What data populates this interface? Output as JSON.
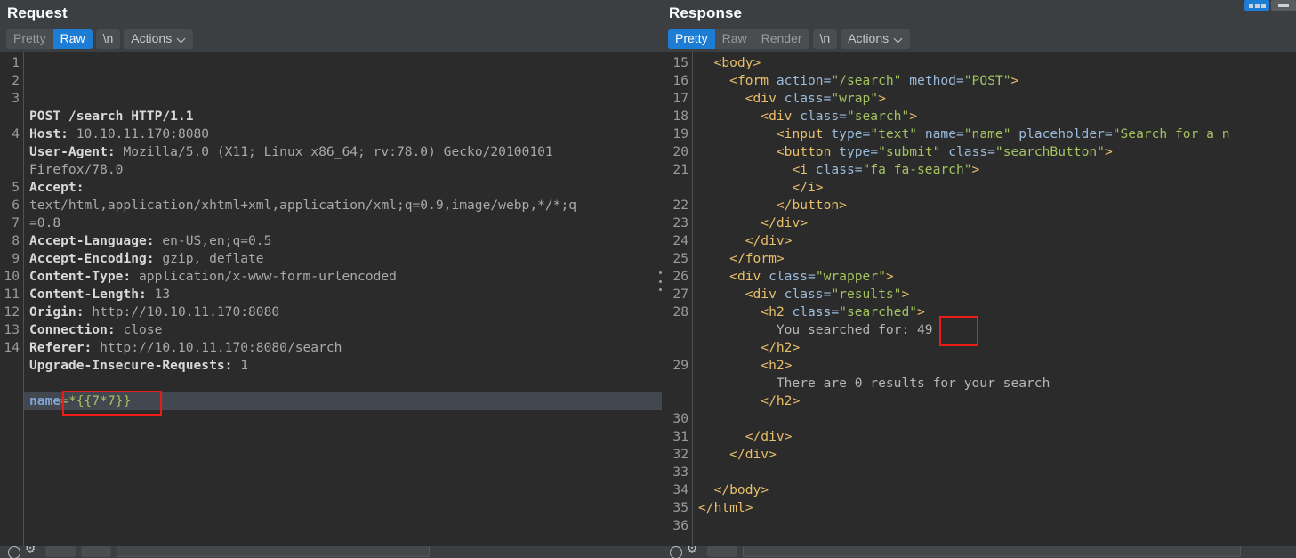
{
  "request": {
    "title": "Request",
    "tabs": [
      {
        "label": "Pretty",
        "state": "inactive"
      },
      {
        "label": "Raw",
        "state": "active"
      },
      {
        "label": "\\n",
        "state": "plain"
      }
    ],
    "actions_label": "Actions",
    "line_numbers": [
      "1",
      "2",
      "3",
      "",
      "4",
      "",
      "",
      "5",
      "6",
      "7",
      "8",
      "9",
      "10",
      "11",
      "12",
      "13",
      "14"
    ],
    "lines": [
      {
        "n": "1",
        "segments": [
          {
            "t": "POST /search HTTP/1.1",
            "c": "r-key"
          }
        ]
      },
      {
        "n": "2",
        "segments": [
          {
            "t": "Host: ",
            "c": "r-key"
          },
          {
            "t": "10.10.11.170:8080",
            "c": "r-val"
          }
        ]
      },
      {
        "n": "3",
        "segments": [
          {
            "t": "User-Agent: ",
            "c": "r-key"
          },
          {
            "t": "Mozilla/5.0 (X11; Linux x86_64; rv:78.0) Gecko/20100101",
            "c": "r-val"
          }
        ]
      },
      {
        "n": "",
        "segments": [
          {
            "t": "Firefox/78.0",
            "c": "r-val"
          }
        ]
      },
      {
        "n": "4",
        "segments": [
          {
            "t": "Accept:",
            "c": "r-key"
          }
        ]
      },
      {
        "n": "",
        "segments": [
          {
            "t": "text/html,application/xhtml+xml,application/xml;q=0.9,image/webp,*/*;q",
            "c": "r-val"
          }
        ]
      },
      {
        "n": "",
        "segments": [
          {
            "t": "=0.8",
            "c": "r-val"
          }
        ]
      },
      {
        "n": "5",
        "segments": [
          {
            "t": "Accept-Language: ",
            "c": "r-key"
          },
          {
            "t": "en-US,en;q=0.5",
            "c": "r-val"
          }
        ]
      },
      {
        "n": "6",
        "segments": [
          {
            "t": "Accept-Encoding: ",
            "c": "r-key"
          },
          {
            "t": "gzip, deflate",
            "c": "r-val"
          }
        ]
      },
      {
        "n": "7",
        "segments": [
          {
            "t": "Content-Type: ",
            "c": "r-key"
          },
          {
            "t": "application/x-www-form-urlencoded",
            "c": "r-val"
          }
        ]
      },
      {
        "n": "8",
        "segments": [
          {
            "t": "Content-Length: ",
            "c": "r-key"
          },
          {
            "t": "13",
            "c": "r-val"
          }
        ]
      },
      {
        "n": "9",
        "segments": [
          {
            "t": "Origin: ",
            "c": "r-key"
          },
          {
            "t": "http://10.10.11.170:8080",
            "c": "r-val"
          }
        ]
      },
      {
        "n": "10",
        "segments": [
          {
            "t": "Connection: ",
            "c": "r-key"
          },
          {
            "t": "close",
            "c": "r-val"
          }
        ]
      },
      {
        "n": "11",
        "segments": [
          {
            "t": "Referer: ",
            "c": "r-key"
          },
          {
            "t": "http://10.10.11.170:8080/search",
            "c": "r-val"
          }
        ]
      },
      {
        "n": "12",
        "segments": [
          {
            "t": "Upgrade-Insecure-Requests: ",
            "c": "r-key"
          },
          {
            "t": "1",
            "c": "r-val"
          }
        ]
      },
      {
        "n": "13",
        "segments": [
          {
            "t": "",
            "c": "r-val"
          }
        ]
      },
      {
        "n": "14",
        "segments": [
          {
            "t": "name",
            "c": "r-name"
          },
          {
            "t": "=*{{7*7}}",
            "c": "r-green"
          }
        ]
      }
    ],
    "payload_value": "name=*{{7*7}}"
  },
  "response": {
    "title": "Response",
    "tabs": [
      {
        "label": "Pretty",
        "state": "active"
      },
      {
        "label": "Raw",
        "state": "plain"
      },
      {
        "label": "Render",
        "state": "plain"
      },
      {
        "label": "\\n",
        "state": "plain"
      }
    ],
    "actions_label": "Actions",
    "lines": [
      {
        "n": "15",
        "segments": [
          {
            "t": "  ",
            "c": "h-text"
          },
          {
            "t": "<body>",
            "c": "h-tag"
          }
        ]
      },
      {
        "n": "16",
        "segments": [
          {
            "t": "    ",
            "c": "h-text"
          },
          {
            "t": "<form ",
            "c": "h-tag"
          },
          {
            "t": "action=",
            "c": "h-attr"
          },
          {
            "t": "\"/search\"",
            "c": "h-str"
          },
          {
            "t": " method=",
            "c": "h-attr"
          },
          {
            "t": "\"POST\"",
            "c": "h-str"
          },
          {
            "t": ">",
            "c": "h-tag"
          }
        ]
      },
      {
        "n": "17",
        "segments": [
          {
            "t": "      ",
            "c": "h-text"
          },
          {
            "t": "<div ",
            "c": "h-tag"
          },
          {
            "t": "class=",
            "c": "h-attr"
          },
          {
            "t": "\"wrap\"",
            "c": "h-str"
          },
          {
            "t": ">",
            "c": "h-tag"
          }
        ]
      },
      {
        "n": "18",
        "segments": [
          {
            "t": "        ",
            "c": "h-text"
          },
          {
            "t": "<div ",
            "c": "h-tag"
          },
          {
            "t": "class=",
            "c": "h-attr"
          },
          {
            "t": "\"search\"",
            "c": "h-str"
          },
          {
            "t": ">",
            "c": "h-tag"
          }
        ]
      },
      {
        "n": "19",
        "segments": [
          {
            "t": "          ",
            "c": "h-text"
          },
          {
            "t": "<input ",
            "c": "h-tag"
          },
          {
            "t": "type=",
            "c": "h-attr"
          },
          {
            "t": "\"text\"",
            "c": "h-str"
          },
          {
            "t": " name=",
            "c": "h-attr"
          },
          {
            "t": "\"name\"",
            "c": "h-str"
          },
          {
            "t": " placeholder=",
            "c": "h-attr"
          },
          {
            "t": "\"Search for a n",
            "c": "h-str"
          }
        ]
      },
      {
        "n": "20",
        "segments": [
          {
            "t": "          ",
            "c": "h-text"
          },
          {
            "t": "<button ",
            "c": "h-tag"
          },
          {
            "t": "type=",
            "c": "h-attr"
          },
          {
            "t": "\"submit\"",
            "c": "h-str"
          },
          {
            "t": " class=",
            "c": "h-attr"
          },
          {
            "t": "\"searchButton\"",
            "c": "h-str"
          },
          {
            "t": ">",
            "c": "h-tag"
          }
        ]
      },
      {
        "n": "21",
        "segments": [
          {
            "t": "            ",
            "c": "h-text"
          },
          {
            "t": "<i ",
            "c": "h-tag"
          },
          {
            "t": "class=",
            "c": "h-attr"
          },
          {
            "t": "\"fa fa-search\"",
            "c": "h-str"
          },
          {
            "t": ">",
            "c": "h-tag"
          }
        ]
      },
      {
        "n": "",
        "segments": [
          {
            "t": "            ",
            "c": "h-text"
          },
          {
            "t": "</i>",
            "c": "h-tag"
          }
        ]
      },
      {
        "n": "22",
        "segments": [
          {
            "t": "          ",
            "c": "h-text"
          },
          {
            "t": "</button>",
            "c": "h-tag"
          }
        ]
      },
      {
        "n": "23",
        "segments": [
          {
            "t": "        ",
            "c": "h-text"
          },
          {
            "t": "</div>",
            "c": "h-tag"
          }
        ]
      },
      {
        "n": "24",
        "segments": [
          {
            "t": "      ",
            "c": "h-text"
          },
          {
            "t": "</div>",
            "c": "h-tag"
          }
        ]
      },
      {
        "n": "25",
        "segments": [
          {
            "t": "    ",
            "c": "h-text"
          },
          {
            "t": "</form>",
            "c": "h-tag"
          }
        ]
      },
      {
        "n": "26",
        "segments": [
          {
            "t": "    ",
            "c": "h-text"
          },
          {
            "t": "<div ",
            "c": "h-tag"
          },
          {
            "t": "class=",
            "c": "h-attr"
          },
          {
            "t": "\"wrapper\"",
            "c": "h-str"
          },
          {
            "t": ">",
            "c": "h-tag"
          }
        ]
      },
      {
        "n": "27",
        "segments": [
          {
            "t": "      ",
            "c": "h-text"
          },
          {
            "t": "<div ",
            "c": "h-tag"
          },
          {
            "t": "class=",
            "c": "h-attr"
          },
          {
            "t": "\"results\"",
            "c": "h-str"
          },
          {
            "t": ">",
            "c": "h-tag"
          }
        ]
      },
      {
        "n": "28",
        "segments": [
          {
            "t": "        ",
            "c": "h-text"
          },
          {
            "t": "<h2 ",
            "c": "h-tag"
          },
          {
            "t": "class=",
            "c": "h-attr"
          },
          {
            "t": "\"searched\"",
            "c": "h-str"
          },
          {
            "t": ">",
            "c": "h-tag"
          }
        ]
      },
      {
        "n": "",
        "segments": [
          {
            "t": "          You searched for: 49",
            "c": "h-text"
          }
        ]
      },
      {
        "n": "",
        "segments": [
          {
            "t": "        ",
            "c": "h-text"
          },
          {
            "t": "</h2>",
            "c": "h-tag"
          }
        ]
      },
      {
        "n": "29",
        "segments": [
          {
            "t": "        ",
            "c": "h-text"
          },
          {
            "t": "<h2>",
            "c": "h-tag"
          }
        ]
      },
      {
        "n": "",
        "segments": [
          {
            "t": "          There are 0 results for your search",
            "c": "h-text"
          }
        ]
      },
      {
        "n": "",
        "segments": [
          {
            "t": "        ",
            "c": "h-text"
          },
          {
            "t": "</h2>",
            "c": "h-tag"
          }
        ]
      },
      {
        "n": "30",
        "segments": [
          {
            "t": "",
            "c": "h-text"
          }
        ]
      },
      {
        "n": "31",
        "segments": [
          {
            "t": "      ",
            "c": "h-text"
          },
          {
            "t": "</div>",
            "c": "h-tag"
          }
        ]
      },
      {
        "n": "32",
        "segments": [
          {
            "t": "    ",
            "c": "h-text"
          },
          {
            "t": "</div>",
            "c": "h-tag"
          }
        ]
      },
      {
        "n": "33",
        "segments": [
          {
            "t": "",
            "c": "h-text"
          }
        ]
      },
      {
        "n": "34",
        "segments": [
          {
            "t": "  ",
            "c": "h-text"
          },
          {
            "t": "</body>",
            "c": "h-tag"
          }
        ]
      },
      {
        "n": "35",
        "segments": [
          {
            "t": "",
            "c": "h-text"
          },
          {
            "t": "</html>",
            "c": "h-tag"
          }
        ]
      },
      {
        "n": "36",
        "segments": [
          {
            "t": "",
            "c": "h-text"
          }
        ]
      }
    ],
    "highlighted_value": "49"
  },
  "annotations": {
    "request_payload_box": "name=*{{7*7}}",
    "response_result_box": "49",
    "box_color": "#ee1b1b"
  },
  "theme": {
    "accent": "#1d7dd4",
    "editor_bg": "#2b2b2b",
    "chrome_bg": "#3c3f41",
    "selection_bg": "#43474f"
  }
}
